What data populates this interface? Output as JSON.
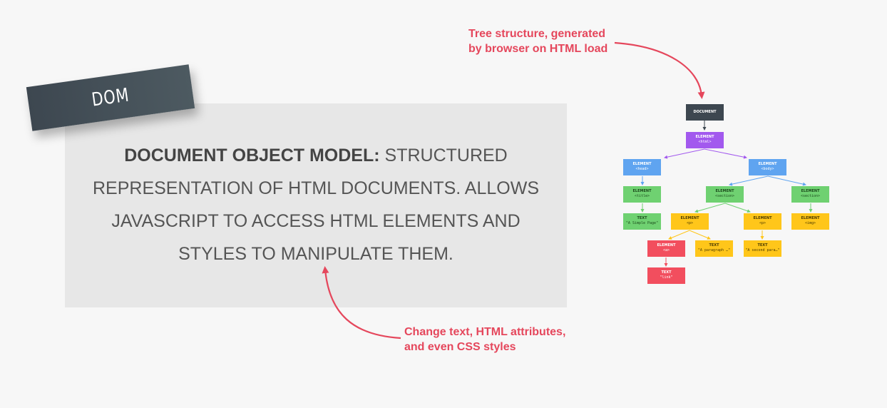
{
  "tag": {
    "label": "DOM"
  },
  "definition": {
    "term": "DOCUMENT OBJECT MODEL:",
    "text": " STRUCTURED REPRESENTATION OF HTML DOCUMENTS. ALLOWS JAVASCRIPT TO ACCESS HTML ELEMENTS AND STYLES TO MANIPULATE THEM."
  },
  "annotations": {
    "top": {
      "line1": "Tree structure, generated",
      "line2": "by browser on HTML load"
    },
    "bottom": {
      "line1": "Change text, HTML attributes,",
      "line2": "and even CSS styles"
    }
  },
  "colors": {
    "accent": "#e5475c",
    "document": "#3d4750",
    "purple": "#a259ee",
    "blue": "#5fa4f0",
    "green": "#6fd171",
    "yellow": "#ffc61a",
    "red": "#f24e5e"
  },
  "tree": {
    "document": {
      "title": "DOCUMENT"
    },
    "html": {
      "title": "ELEMENT",
      "code": "<html>"
    },
    "head": {
      "title": "ELEMENT",
      "code": "<head>"
    },
    "body": {
      "title": "ELEMENT",
      "code": "<body>"
    },
    "title": {
      "title": "ELEMENT",
      "code": "<title>"
    },
    "section1": {
      "title": "ELEMENT",
      "code": "<section>"
    },
    "section2": {
      "title": "ELEMENT",
      "code": "<section>"
    },
    "title_text": {
      "title": "TEXT",
      "code": "\"A Simple Page\""
    },
    "p1": {
      "title": "ELEMENT",
      "code": "<p>"
    },
    "p2": {
      "title": "ELEMENT",
      "code": "<p>"
    },
    "img": {
      "title": "ELEMENT",
      "code": "<img>"
    },
    "a": {
      "title": "ELEMENT",
      "code": "<a>"
    },
    "p1_text": {
      "title": "TEXT",
      "code": "\"A paragraph …\""
    },
    "p2_text": {
      "title": "TEXT",
      "code": "\"A second para…\""
    },
    "a_text": {
      "title": "TEXT",
      "code": "\"link\""
    }
  }
}
